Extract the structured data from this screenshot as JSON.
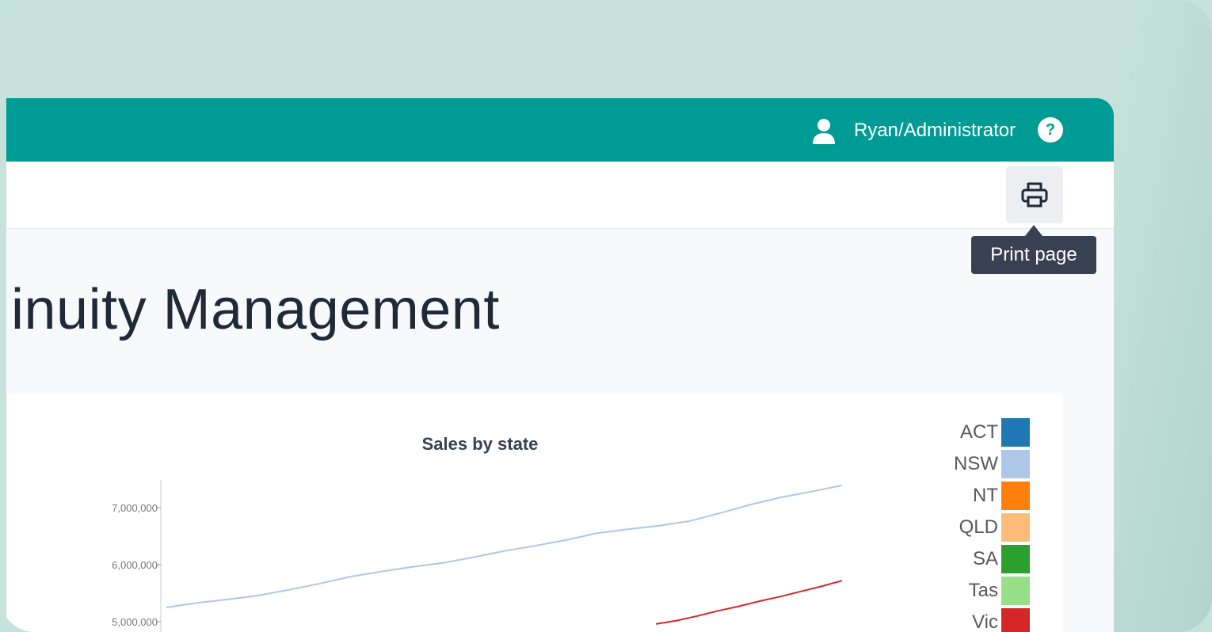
{
  "header": {
    "user_label": "Ryan/Administrator",
    "help_symbol": "?",
    "brand_color": "#009b94"
  },
  "toolbar": {
    "print_tooltip": "Print page"
  },
  "page": {
    "title_fragment": "inuity Management"
  },
  "chart_data": {
    "type": "line",
    "title": "Sales by state",
    "y_ticks": [
      "7,000,000",
      "6,000,000",
      "5,000,000"
    ],
    "y_tick_values": [
      7000000,
      6000000,
      5000000
    ],
    "ylim_visible": [
      4950000,
      7470000
    ],
    "legend": {
      "placement": "right",
      "items": [
        {
          "name": "ACT",
          "color": "#1f77b4"
        },
        {
          "name": "NSW",
          "color": "#aec7e8"
        },
        {
          "name": "NT",
          "color": "#ff7f0e"
        },
        {
          "name": "QLD",
          "color": "#ffbb78"
        },
        {
          "name": "SA",
          "color": "#2ca02c"
        },
        {
          "name": "Tas",
          "color": "#98df8a"
        },
        {
          "name": "Vic",
          "color": "#d62728"
        }
      ]
    },
    "series": [
      {
        "name": "NSW",
        "color": "#aec7e8",
        "values": [
          5250000,
          5330000,
          5390000,
          5460000,
          5560000,
          5670000,
          5790000,
          5880000,
          5960000,
          6030000,
          6130000,
          6240000,
          6330000,
          6430000,
          6550000,
          6620000,
          6680000,
          6760000,
          6900000,
          7050000,
          7180000,
          7280000,
          7390000
        ]
      },
      {
        "name": "Vic",
        "color": "#d62728",
        "values": [
          4960000,
          5020000,
          5100000,
          5190000,
          5270000,
          5360000,
          5440000,
          5530000,
          5620000,
          5720000
        ]
      }
    ]
  }
}
